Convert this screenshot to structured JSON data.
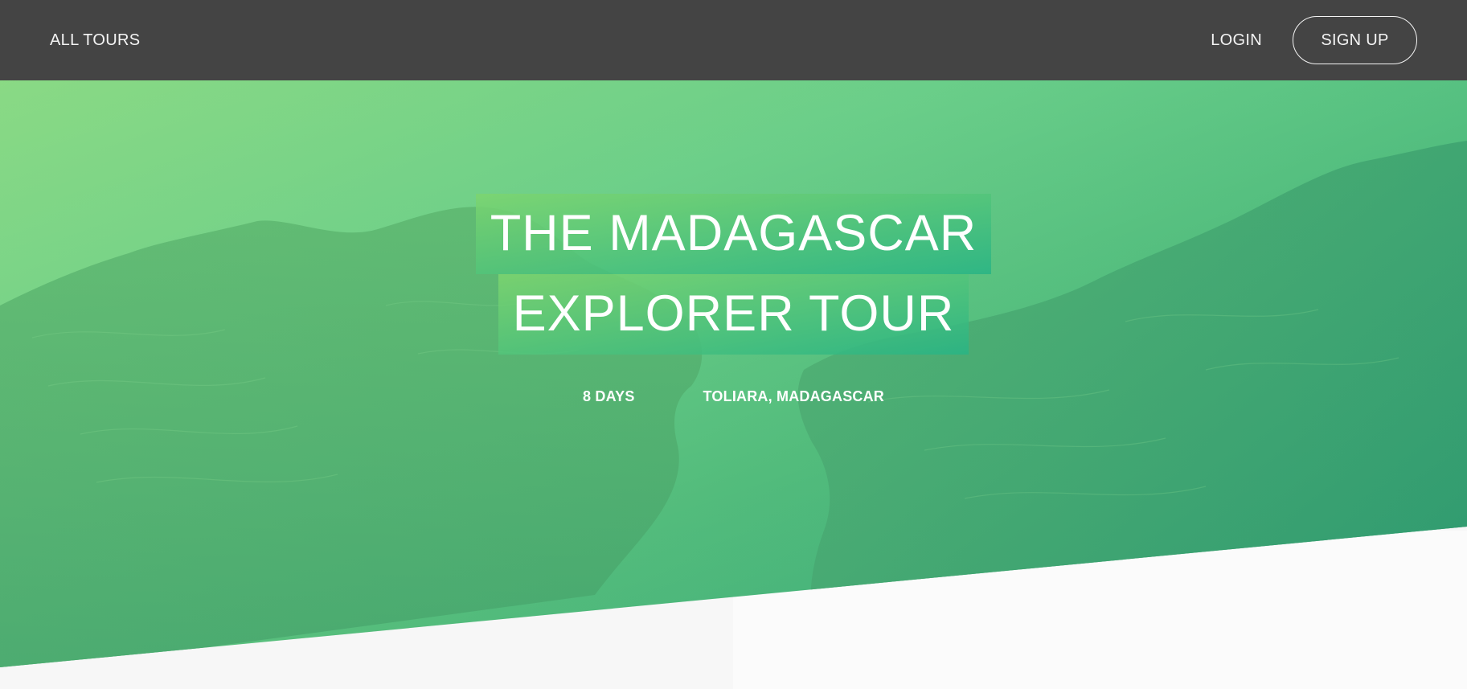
{
  "header": {
    "all_tours_label": "ALL TOURS",
    "login_label": "LOGIN",
    "signup_label": "SIGN UP",
    "logo_icon": "crown-logo-icon"
  },
  "hero": {
    "title_line_1": "THE MADAGASCAR",
    "title_line_2": "EXPLORER TOUR",
    "duration": "8 DAYS",
    "location": "TOLIARA, MADAGASCAR"
  },
  "colors": {
    "header_bg": "#444444",
    "gradient_start": "#7dd56f",
    "gradient_end": "#28b485",
    "page_bg": "#f7f7f7"
  }
}
